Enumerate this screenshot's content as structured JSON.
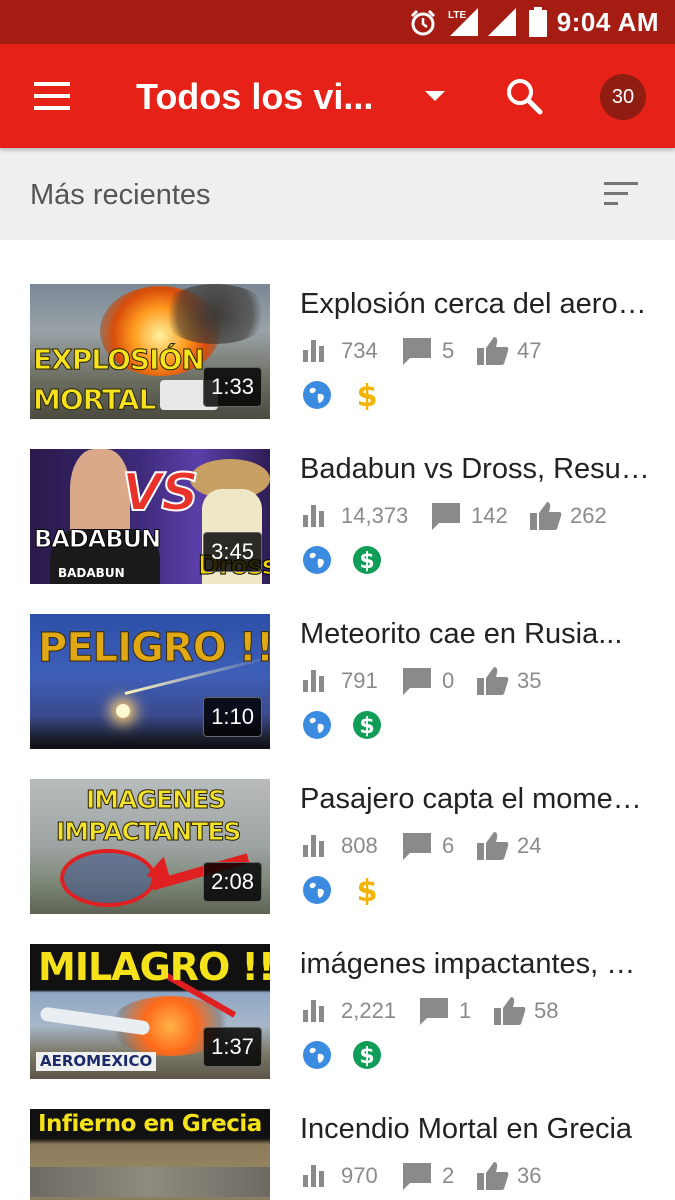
{
  "status_bar": {
    "time": "9:04 AM",
    "network": "LTE"
  },
  "app_bar": {
    "title": "Todos los vi...",
    "notification_count": "30",
    "icons": [
      "menu-icon",
      "dropdown-arrow-icon",
      "search-icon"
    ]
  },
  "sort": {
    "label": "Más recientes",
    "icon": "sort-icon"
  },
  "colors": {
    "app_bar": "#e62117",
    "status_bar": "#a51c13",
    "badge": "#8f1d12",
    "globe": "#3b8be0",
    "money_orange": "#f4b400",
    "money_green": "#0f9d58"
  },
  "videos": [
    {
      "title": "Explosión cerca del aeropuerto",
      "views": "734",
      "comments": "5",
      "likes": "47",
      "duration": "1:33",
      "thumb_text": [
        "EXPLOSIÓN",
        "MORTAL"
      ],
      "monetization": "orange-dollar"
    },
    {
      "title": "Badabun vs Dross, Resumen",
      "views": "14,373",
      "comments": "142",
      "likes": "262",
      "duration": "3:45",
      "thumb_text": [
        "VS",
        "BADABUN",
        "Dross",
        "BADABUN"
      ],
      "monetization": "green-dollar"
    },
    {
      "title": "Meteorito cae en Rusia...",
      "views": "791",
      "comments": "0",
      "likes": "35",
      "duration": "1:10",
      "thumb_text": [
        "PELIGRO !!"
      ],
      "monetization": "green-dollar"
    },
    {
      "title": "Pasajero capta el momento",
      "views": "808",
      "comments": "6",
      "likes": "24",
      "duration": "2:08",
      "thumb_text": [
        "IMAGENES",
        "IMPACTANTES"
      ],
      "monetization": "orange-dollar"
    },
    {
      "title": "imágenes impactantes, avión",
      "views": "2,221",
      "comments": "1",
      "likes": "58",
      "duration": "1:37",
      "thumb_text": [
        "MILAGRO !!",
        "AEROMEXICO"
      ],
      "monetization": "green-dollar"
    },
    {
      "title": "Incendio Mortal en Grecia",
      "views": "970",
      "comments": "2",
      "likes": "36",
      "duration": "",
      "thumb_text": [
        "Infierno en Grecia"
      ],
      "monetization": "green-dollar"
    }
  ]
}
